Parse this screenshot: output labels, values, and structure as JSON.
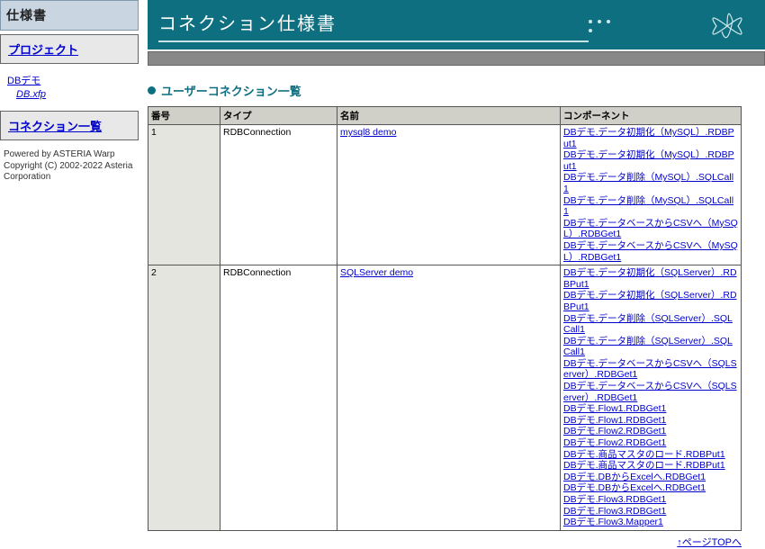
{
  "sidebar": {
    "title": "仕様書",
    "project_label": "プロジェクト",
    "demo_label": "DBデモ",
    "xfp_label": "DB.xfp",
    "conn_list_label": "コネクション一覧",
    "footer1": "Powered by ASTERIA Warp",
    "footer2": "Copyright (C) 2002-2022 Asteria Corporation"
  },
  "banner": {
    "title": "コネクション仕様書"
  },
  "section": {
    "heading": "ユーザーコネクション一覧"
  },
  "table": {
    "headers": {
      "no": "番号",
      "type": "タイプ",
      "name": "名前",
      "comp": "コンポーネント"
    },
    "rows": [
      {
        "no": "1",
        "type": "RDBConnection",
        "name": "mysql8 demo",
        "components": [
          "DBデモ.データ初期化（MySQL）.RDBPut1",
          "DBデモ.データ初期化（MySQL）.RDBPut1",
          "DBデモ.データ削除（MySQL）.SQLCall1",
          "DBデモ.データ削除（MySQL）.SQLCall1",
          "DBデモ.データベースからCSVへ（MySQL）.RDBGet1",
          "DBデモ.データベースからCSVへ（MySQL）.RDBGet1"
        ]
      },
      {
        "no": "2",
        "type": "RDBConnection",
        "name": "SQLServer demo",
        "components": [
          "DBデモ.データ初期化（SQLServer）.RDBPut1",
          "DBデモ.データ初期化（SQLServer）.RDBPut1",
          "DBデモ.データ削除（SQLServer）.SQLCall1",
          "DBデモ.データ削除（SQLServer）.SQLCall1",
          "DBデモ.データベースからCSVへ（SQLServer）.RDBGet1",
          "DBデモ.データベースからCSVへ（SQLServer）.RDBGet1",
          "DBデモ.Flow1.RDBGet1",
          "DBデモ.Flow1.RDBGet1",
          "DBデモ.Flow2.RDBGet1",
          "DBデモ.Flow2.RDBGet1",
          "DBデモ.商品マスタのロード.RDBPut1",
          "DBデモ.商品マスタのロード.RDBPut1",
          "DBデモ.DBからExcelへ.RDBGet1",
          "DBデモ.DBからExcelへ.RDBGet1",
          "DBデモ.Flow3.RDBGet1",
          "DBデモ.Flow3.RDBGet1",
          "DBデモ.Flow3.Mapper1"
        ]
      }
    ]
  },
  "toplink": "↑ページTOPへ"
}
